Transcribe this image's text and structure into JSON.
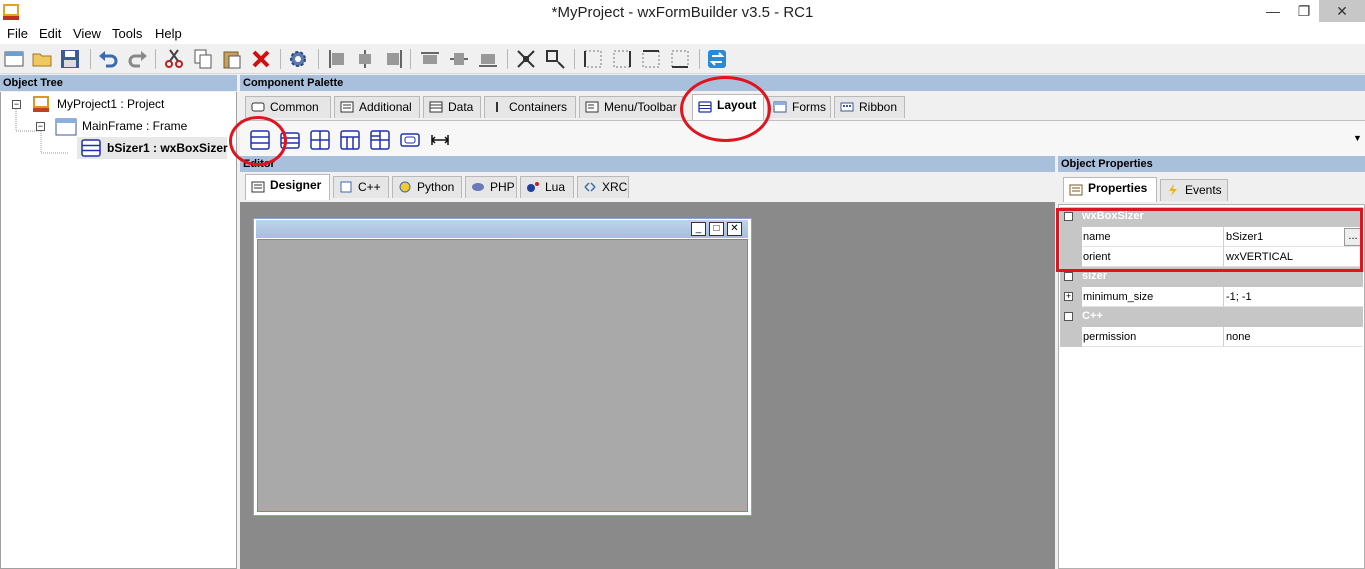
{
  "window": {
    "title": "*MyProject - wxFormBuilder v3.5 - RC1",
    "minimize": "—",
    "restore": "❐",
    "close": "✕"
  },
  "menu": [
    "File",
    "Edit",
    "View",
    "Tools",
    "Help"
  ],
  "object_tree": {
    "header": "Object Tree",
    "items": [
      "MyProject1 : Project",
      "MainFrame : Frame",
      "bSizer1 : wxBoxSizer"
    ]
  },
  "palette": {
    "header": "Component Palette",
    "tabs": [
      "Common",
      "Additional",
      "Data",
      "Containers",
      "Menu/Toolbar",
      "Layout",
      "Forms",
      "Ribbon"
    ],
    "active_tab": "Layout"
  },
  "editor": {
    "header": "Editor",
    "tabs": [
      "Designer",
      "C++",
      "Python",
      "PHP",
      "Lua",
      "XRC"
    ],
    "frame_buttons": [
      "_",
      "□",
      "✕"
    ]
  },
  "properties": {
    "header": "Object Properties",
    "tabs": [
      "Properties",
      "Events"
    ],
    "categories": [
      {
        "name": "wxBoxSizer",
        "rows": [
          {
            "name": "name",
            "value": "bSizer1"
          },
          {
            "name": "orient",
            "value": "wxVERTICAL"
          }
        ]
      },
      {
        "name": "sizer",
        "rows": [
          {
            "name": "minimum_size",
            "value": "-1; -1"
          }
        ]
      },
      {
        "name": "C++",
        "rows": [
          {
            "name": "permission",
            "value": "none"
          }
        ]
      }
    ],
    "ellipsis": "..."
  },
  "colors": {
    "highlight": "#e0141e",
    "panel_header": "#a9c0dc",
    "editor_bg": "#8a8a8a"
  }
}
